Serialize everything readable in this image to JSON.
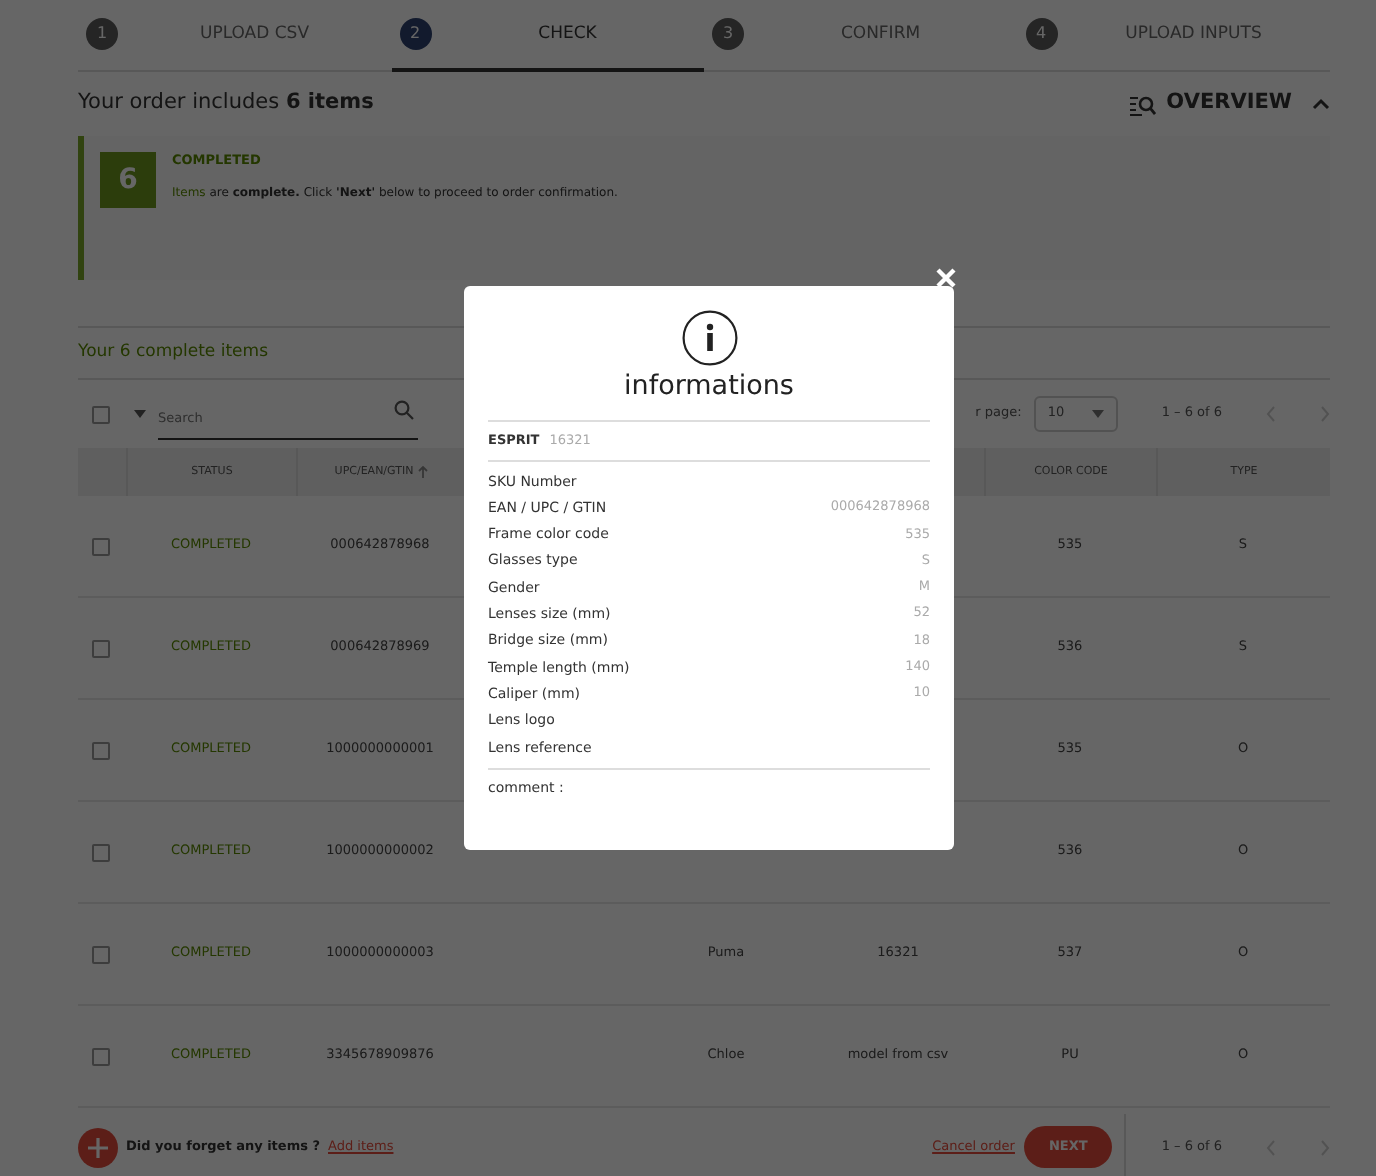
{
  "stepper": [
    {
      "number": "1",
      "label": "UPLOAD CSV",
      "selected": false
    },
    {
      "number": "2",
      "label": "CHECK",
      "selected": true
    },
    {
      "number": "3",
      "label": "CONFIRM",
      "selected": false
    },
    {
      "number": "4",
      "label": "UPLOAD INPUTS",
      "selected": false
    }
  ],
  "order_summary": "Your order includes **6 items**",
  "overview": {
    "label": "OVERVIEW",
    "expanded": true
  },
  "alert": {
    "count": "6",
    "status": "COMPLETED",
    "lead": "Items",
    "message": "are **complete.** Click **'Next'** below to proceed to order confirmation."
  },
  "section_title": "Your 6 complete items",
  "toolbar": {
    "select_all_checked": false,
    "search_placeholder": "Search",
    "per_page_label": "r page:",
    "per_page": "10",
    "range": "1 – 6 of 6"
  },
  "table": {
    "columns": [
      {
        "label": "STATUS"
      },
      {
        "label": "UPC/EAN/GTIN",
        "sorted": true
      },
      null,
      null,
      {
        "label": "COLOR CODE"
      },
      {
        "label": "TYPE"
      }
    ],
    "rows": [
      {
        "checked": false,
        "status": "COMPLETED",
        "upc": "000642878968",
        "color_code": "535",
        "type": "S"
      },
      {
        "checked": false,
        "status": "COMPLETED",
        "upc": "000642878969",
        "color_code": "536",
        "type": "S"
      },
      {
        "checked": false,
        "status": "COMPLETED",
        "upc": "1000000000001",
        "color_code": "535",
        "type": "O"
      },
      {
        "checked": false,
        "status": "COMPLETED",
        "upc": "1000000000002",
        "color_code": "536",
        "type": "O"
      },
      {
        "checked": false,
        "status": "COMPLETED",
        "upc": "1000000000003",
        "brand": "Puma",
        "model": "16321",
        "color_code": "537",
        "type": "O"
      },
      {
        "checked": false,
        "status": "COMPLETED",
        "upc": "3345678909876",
        "brand": "Chloe",
        "model": "model from csv",
        "color_code": "PU",
        "type": "O"
      }
    ]
  },
  "footer": {
    "question": "Did you forget any items ?",
    "add_link": "Add items",
    "cancel_link": "Cancel order",
    "next_button": "NEXT",
    "range": "1 – 6 of 6"
  },
  "modal": {
    "title": "informations",
    "brand": "ESPRIT",
    "model": "16321",
    "fields": [
      {
        "label": "SKU Number"
      },
      {
        "label": "EAN / UPC / GTIN",
        "value": "000642878968"
      },
      {
        "label": "Frame color code",
        "value": "535"
      },
      {
        "label": "Glasses type",
        "value": "S"
      },
      {
        "label": "Gender",
        "value": "M"
      },
      {
        "label": "Lenses size (mm)",
        "value": "52"
      },
      {
        "label": "Bridge size (mm)",
        "value": "18"
      },
      {
        "label": "Temple length (mm)",
        "value": "140"
      },
      {
        "label": "Caliper (mm)",
        "value": "10"
      },
      {
        "label": "Lens logo"
      },
      {
        "label": "Lens reference"
      }
    ],
    "comment_label": "comment :"
  }
}
